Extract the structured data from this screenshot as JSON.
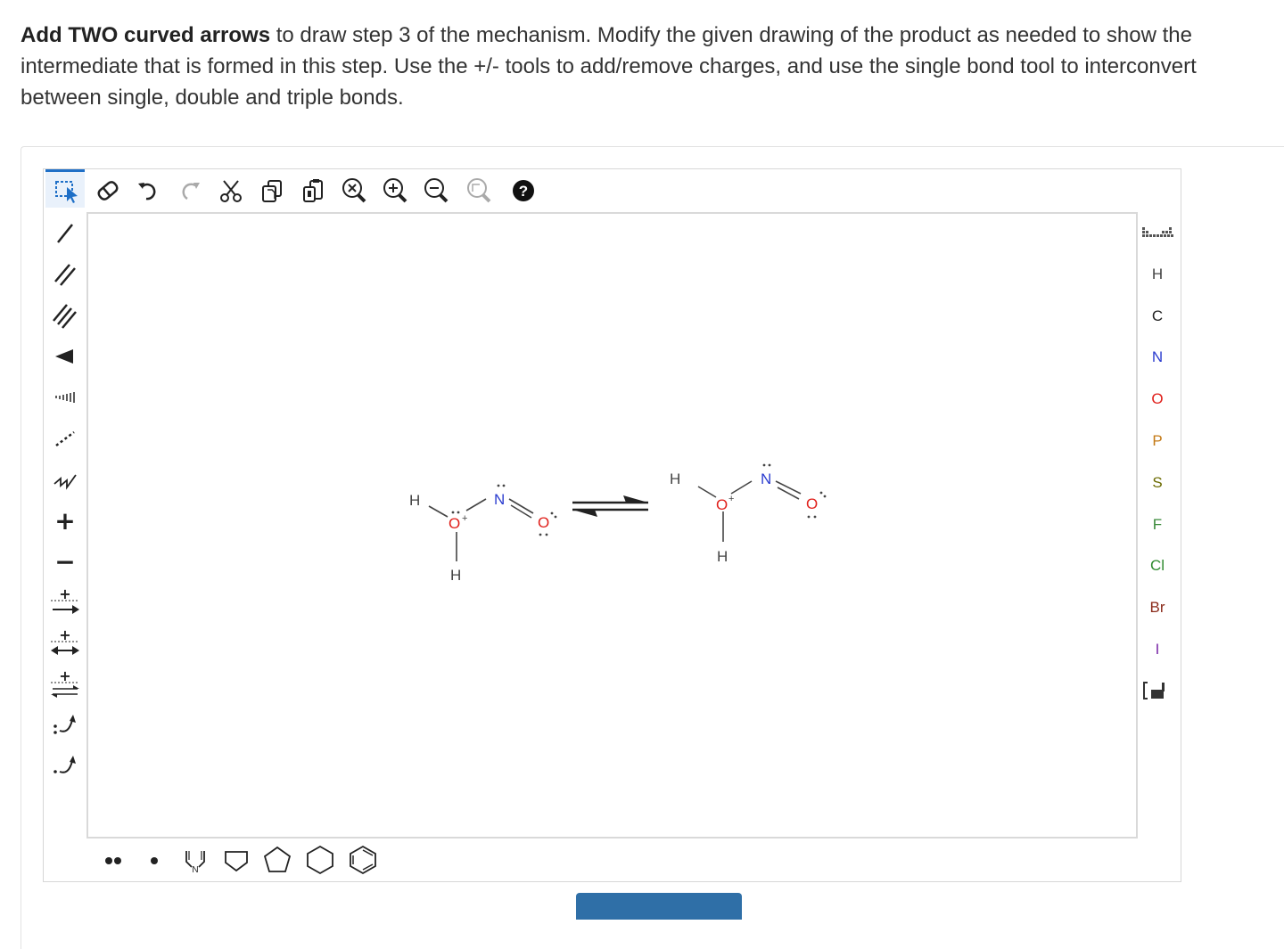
{
  "instructions": {
    "bold_lead": "Add TWO curved arrows",
    "rest": " to draw step 3 of the mechanism.  Modify the given drawing of the product as needed to show the intermediate that is formed in this step. Use the +/- tools to add/remove charges, and use the single bond tool to interconvert between single, double and triple bonds."
  },
  "top_toolbar": [
    {
      "name": "select-tool",
      "icon": "lasso-select-icon"
    },
    {
      "name": "erase-tool",
      "icon": "eraser-icon"
    },
    {
      "name": "undo-tool",
      "icon": "undo-icon"
    },
    {
      "name": "redo-tool",
      "icon": "redo-icon"
    },
    {
      "name": "cut-tool",
      "icon": "scissors-icon"
    },
    {
      "name": "copy-tool",
      "icon": "copy-icon"
    },
    {
      "name": "paste-tool",
      "icon": "paste-icon"
    },
    {
      "name": "zoom-reset-tool",
      "icon": "zoom-reset-icon"
    },
    {
      "name": "zoom-in-tool",
      "icon": "zoom-in-icon"
    },
    {
      "name": "zoom-out-tool",
      "icon": "zoom-out-icon"
    },
    {
      "name": "zoom-fit-tool",
      "icon": "zoom-fit-icon"
    },
    {
      "name": "help-tool",
      "icon": "help-icon"
    }
  ],
  "left_toolbar": {
    "plus": "+",
    "minus": "−"
  },
  "elements": [
    "H",
    "C",
    "N",
    "O",
    "P",
    "S",
    "F",
    "Cl",
    "Br",
    "I"
  ],
  "element_colors": {
    "H": "#444444",
    "C": "#222222",
    "N": "#2b3ccf",
    "O": "#e0201b",
    "P": "#c47a17",
    "S": "#6b6b00",
    "F": "#3a8a3a",
    "Cl": "#2e8b2e",
    "Br": "#8b2b1b",
    "I": "#7a2aa8"
  },
  "molecule_left": {
    "atoms": {
      "h_top": "H",
      "o": "O",
      "o_charge": "+",
      "n": "N",
      "o2": "O",
      "h_bottom": "H"
    }
  },
  "molecule_right": {
    "atoms": {
      "h_top": "H",
      "o": "O",
      "o_charge": "+",
      "n": "N",
      "o2": "O",
      "h_bottom": "H"
    }
  },
  "bottom_toolbar": {
    "pyrrole_label": "N"
  },
  "colors": {
    "accent": "#1e6fc7",
    "submit": "#2f6fa7"
  }
}
